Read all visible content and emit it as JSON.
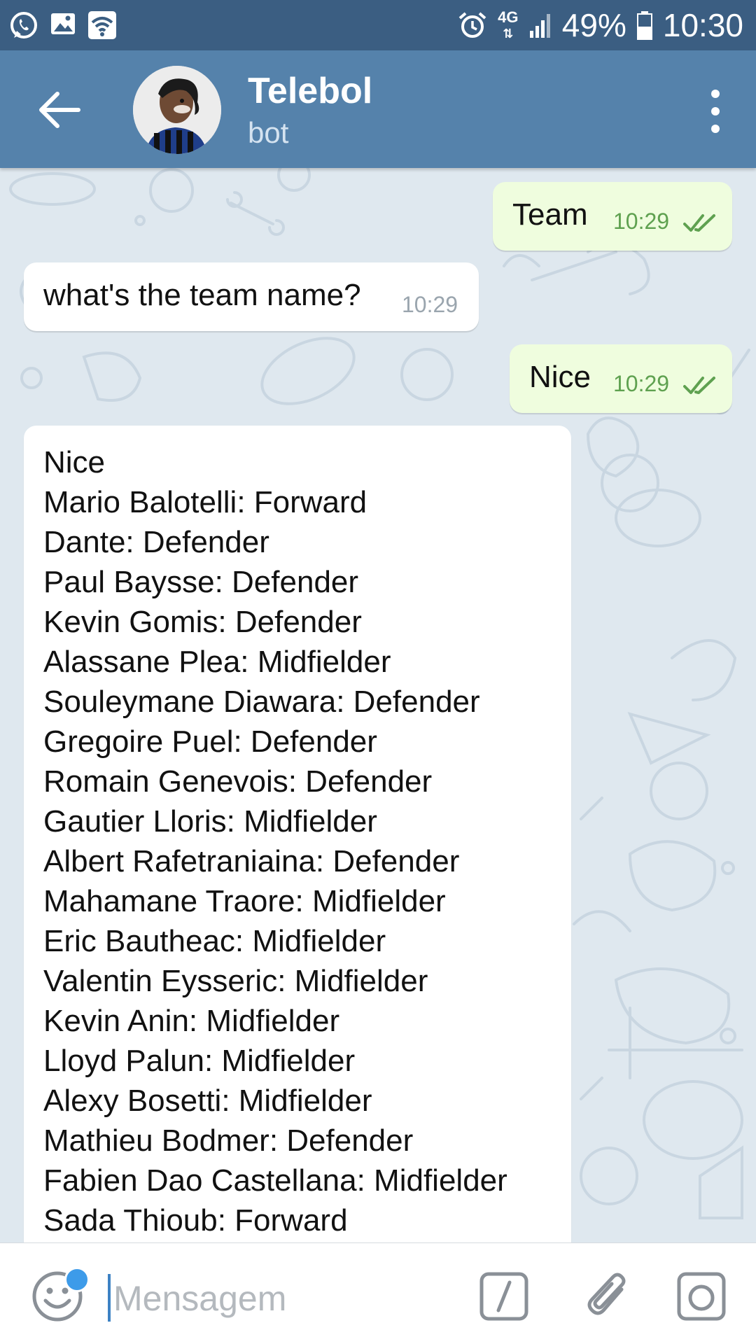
{
  "status_bar": {
    "network": "4G",
    "battery": "49%",
    "time": "10:30",
    "left_icons": [
      "whatsapp-icon",
      "gallery-icon",
      "wifi-icon"
    ],
    "right_icons": [
      "alarm-icon",
      "signal-icon",
      "battery-icon"
    ]
  },
  "header": {
    "title": "Telebol",
    "subtitle": "bot",
    "back_icon": "arrow-left-icon",
    "menu_icon": "more-vertical-icon"
  },
  "messages": [
    {
      "dir": "out",
      "text": "Team",
      "time": "10:29",
      "status": "read"
    },
    {
      "dir": "in",
      "text": "what's the team name?",
      "time": "10:29"
    },
    {
      "dir": "out",
      "text": "Nice",
      "time": "10:29",
      "status": "read"
    },
    {
      "dir": "in",
      "lines": [
        "Nice",
        "Mario Balotelli: Forward",
        "Dante: Defender",
        "Paul Baysse: Defender",
        "Kevin Gomis: Defender",
        "Alassane Plea: Midfielder",
        "Souleymane Diawara: Defender",
        "Gregoire Puel: Defender",
        "Romain Genevois: Defender",
        "Gautier Lloris: Midfielder",
        "Albert Rafetraniaina: Defender",
        "Mahamane Traore: Midfielder",
        "Eric Bautheac: Midfielder",
        "Valentin Eysseric: Midfielder",
        "Kevin Anin: Midfielder",
        "Lloyd Palun: Midfielder",
        "Alexy Bosetti: Midfielder",
        "Mathieu Bodmer: Defender",
        "Fabien Dao Castellana: Midfielder",
        "Sada Thioub: Forward"
      ]
    }
  ],
  "input": {
    "placeholder": "Mensagem",
    "value": "",
    "icons": [
      "emoji-icon",
      "bot-command-icon",
      "paperclip-icon",
      "camera-icon"
    ]
  },
  "colors": {
    "status_bar": "#3b5e82",
    "header": "#5582ab",
    "outgoing_bubble": "#effdde",
    "incoming_bubble": "#ffffff",
    "time_outgoing": "#5fa150",
    "accent_dot": "#3d9be9"
  }
}
